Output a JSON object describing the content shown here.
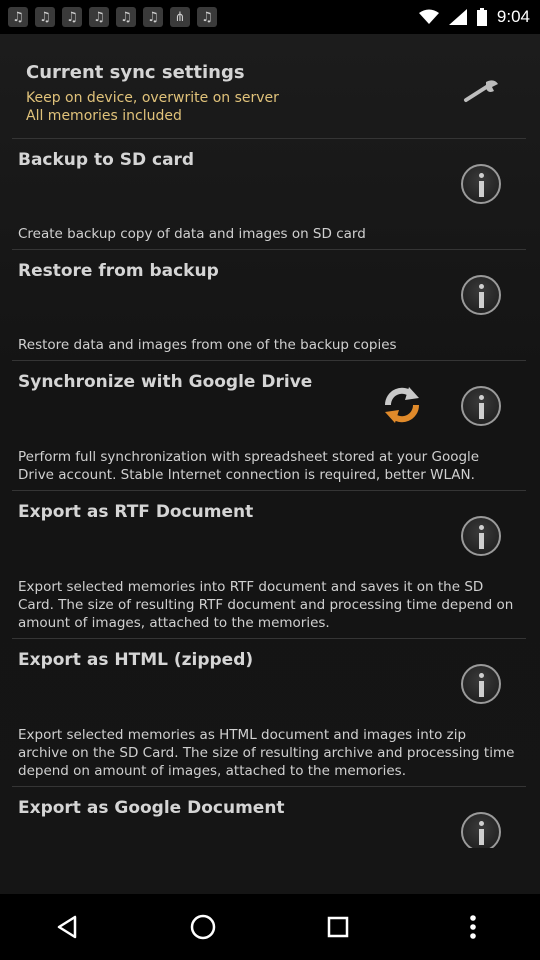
{
  "status_bar": {
    "time": "9:04",
    "left_icons": [
      "music-note-icon",
      "music-note-icon",
      "music-note-icon",
      "music-note-icon",
      "music-note-icon",
      "music-note-icon",
      "share-icon",
      "music-note-icon"
    ]
  },
  "sync": {
    "title": "Current sync settings",
    "line1": "Keep on device, overwrite on server",
    "line2": "All memories included"
  },
  "items": [
    {
      "title": "Backup to SD card",
      "desc": "Create backup copy of data and images on SD card"
    },
    {
      "title": "Restore from backup",
      "desc": "Restore data and images from one of the backup copies"
    },
    {
      "title": "Synchronize with Google Drive",
      "desc": "Perform full synchronization with spreadsheet stored at your Google Drive account. Stable Internet connection is required, better WLAN."
    },
    {
      "title": "Export as RTF Document",
      "desc": "Export selected memories into RTF document and saves it on the SD Card. The size of resulting RTF document and processing time depend on amount of images, attached to the memories."
    },
    {
      "title": "Export as HTML (zipped)",
      "desc": "Export selected memories as HTML document and images into zip archive on the SD Card. The size of resulting archive and processing time depend on amount of images, attached to the memories."
    },
    {
      "title": "Export as Google Document",
      "desc": ""
    }
  ],
  "colors": {
    "accent_text": "#e0c27a",
    "background": "#151515"
  }
}
